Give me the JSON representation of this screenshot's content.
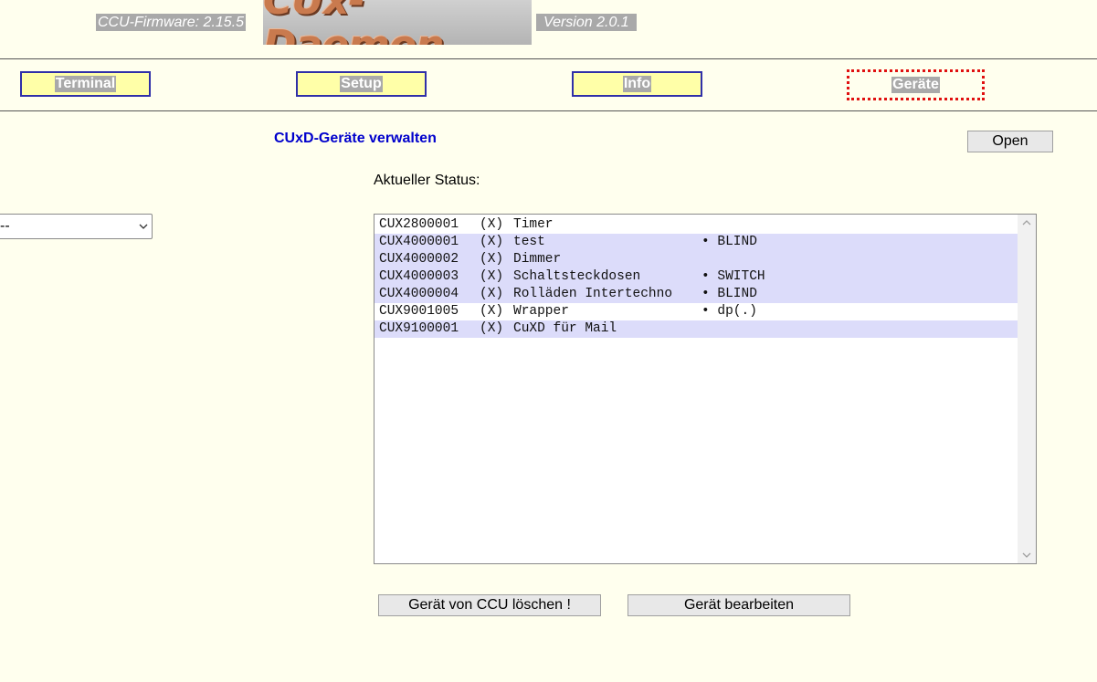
{
  "header": {
    "firmware": "CCU-Firmware: 2.15.5",
    "logo_text": "CUx-Daemon",
    "version": "Version 2.0.1"
  },
  "nav": {
    "terminal": "Terminal",
    "setup": "Setup",
    "info": "Info",
    "geraete": "Geräte"
  },
  "main": {
    "title": "CUxD-Geräte verwalten",
    "open_label": "Open",
    "status_label": "Aktueller Status:",
    "left_select_value": "--",
    "devices": [
      {
        "id": "CUX2800001",
        "flag": "(X)",
        "name": "Timer",
        "type": ""
      },
      {
        "id": "CUX4000001",
        "flag": "(X)",
        "name": "test",
        "type": "• BLIND"
      },
      {
        "id": "CUX4000002",
        "flag": "(X)",
        "name": "Dimmer",
        "type": ""
      },
      {
        "id": "CUX4000003",
        "flag": "(X)",
        "name": "Schaltsteckdosen",
        "type": "• SWITCH"
      },
      {
        "id": "CUX4000004",
        "flag": "(X)",
        "name": "Rolläden Intertechno",
        "type": "• BLIND"
      },
      {
        "id": "CUX9001005",
        "flag": "(X)",
        "name": "Wrapper",
        "type": "• dp(.)"
      },
      {
        "id": "CUX9100001",
        "flag": "(X)",
        "name": "CuXD für Mail",
        "type": ""
      }
    ],
    "delete_label": "Gerät von CCU löschen !",
    "edit_label": "Gerät bearbeiten"
  },
  "colors": {
    "page_bg": "#ffffee",
    "nav_bg": "#ffffa8",
    "nav_border": "#3030a8",
    "active_border": "#e01010",
    "title_color": "#0000cc",
    "row_highlight": "#dcdcfa"
  }
}
